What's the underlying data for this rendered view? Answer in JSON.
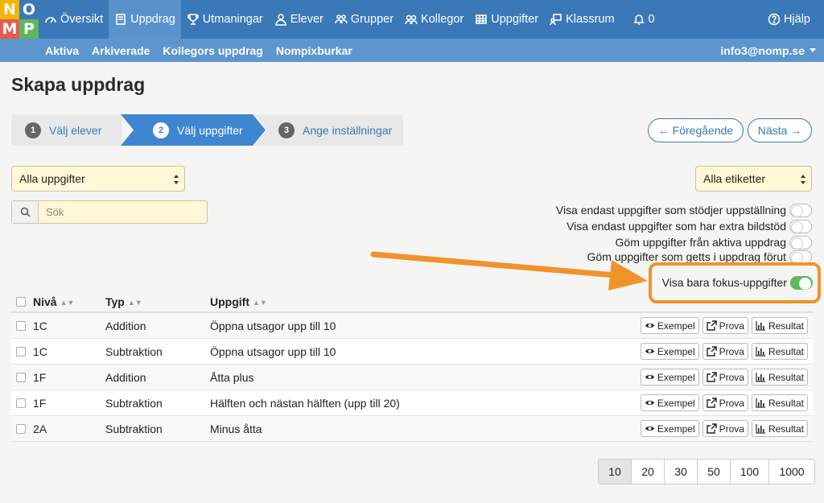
{
  "logo": {
    "letters": [
      "N",
      "O",
      "M",
      "P"
    ],
    "colors": [
      "#f4b400",
      "#3a78b8",
      "#e85a4f",
      "#5cb85c"
    ]
  },
  "topnav": {
    "items": [
      {
        "label": "Översikt",
        "icon": "dashboard-icon"
      },
      {
        "label": "Uppdrag",
        "icon": "book-icon"
      },
      {
        "label": "Utmaningar",
        "icon": "trophy-icon"
      },
      {
        "label": "Elever",
        "icon": "user-icon"
      },
      {
        "label": "Grupper",
        "icon": "group-icon"
      },
      {
        "label": "Kollegor",
        "icon": "colleagues-icon"
      },
      {
        "label": "Uppgifter",
        "icon": "table-icon"
      },
      {
        "label": "Klassrum",
        "icon": "classroom-icon"
      }
    ],
    "notifications": "0",
    "help": "Hjälp"
  },
  "subnav": {
    "items": [
      "Aktiva",
      "Arkiverade",
      "Kollegors uppdrag",
      "Nompixburkar"
    ],
    "user": "info3@nomp.se"
  },
  "page_title": "Skapa uppdrag",
  "stepper": [
    {
      "num": "1",
      "label": "Välj elever"
    },
    {
      "num": "2",
      "label": "Välj uppgifter"
    },
    {
      "num": "3",
      "label": "Ange inställningar"
    }
  ],
  "buttons": {
    "prev": "← Föregående",
    "next": "Nästa →"
  },
  "filters": {
    "tasks_select": "Alla uppgifter",
    "labels_select": "Alla etiketter",
    "search_placeholder": "Sök"
  },
  "toggles": [
    {
      "label": "Visa endast uppgifter som stödjer uppställning",
      "on": false
    },
    {
      "label": "Visa endast uppgifter som har extra bildstöd",
      "on": false
    },
    {
      "label": "Göm uppgifter från aktiva uppdrag",
      "on": false
    },
    {
      "label": "Göm uppgifter som getts i uppdrag förut",
      "on": false
    },
    {
      "label": "Visa bara fokus-uppgifter",
      "on": true
    }
  ],
  "table": {
    "headers": {
      "niva": "Nivå",
      "typ": "Typ",
      "uppgift": "Uppgift"
    },
    "action_labels": {
      "example": "Exempel",
      "try": "Prova",
      "result": "Resultat"
    },
    "rows": [
      {
        "niva": "1C",
        "typ": "Addition",
        "uppgift": "Öppna utsagor upp till 10"
      },
      {
        "niva": "1C",
        "typ": "Subtraktion",
        "uppgift": "Öppna utsagor upp till 10"
      },
      {
        "niva": "1F",
        "typ": "Addition",
        "uppgift": "Åtta plus"
      },
      {
        "niva": "1F",
        "typ": "Subtraktion",
        "uppgift": "Hälften och nästan hälften (upp till 20)"
      },
      {
        "niva": "2A",
        "typ": "Subtraktion",
        "uppgift": "Minus åtta"
      }
    ]
  },
  "pagination": {
    "sizes": [
      "10",
      "20",
      "30",
      "50",
      "100",
      "1000"
    ],
    "active": "10"
  },
  "colors": {
    "primary": "#3a78b8",
    "subnav": "#5d95cf",
    "highlight": "#f0932b",
    "toggle_on": "#5cb85c",
    "input_bg": "#fff7d6"
  }
}
